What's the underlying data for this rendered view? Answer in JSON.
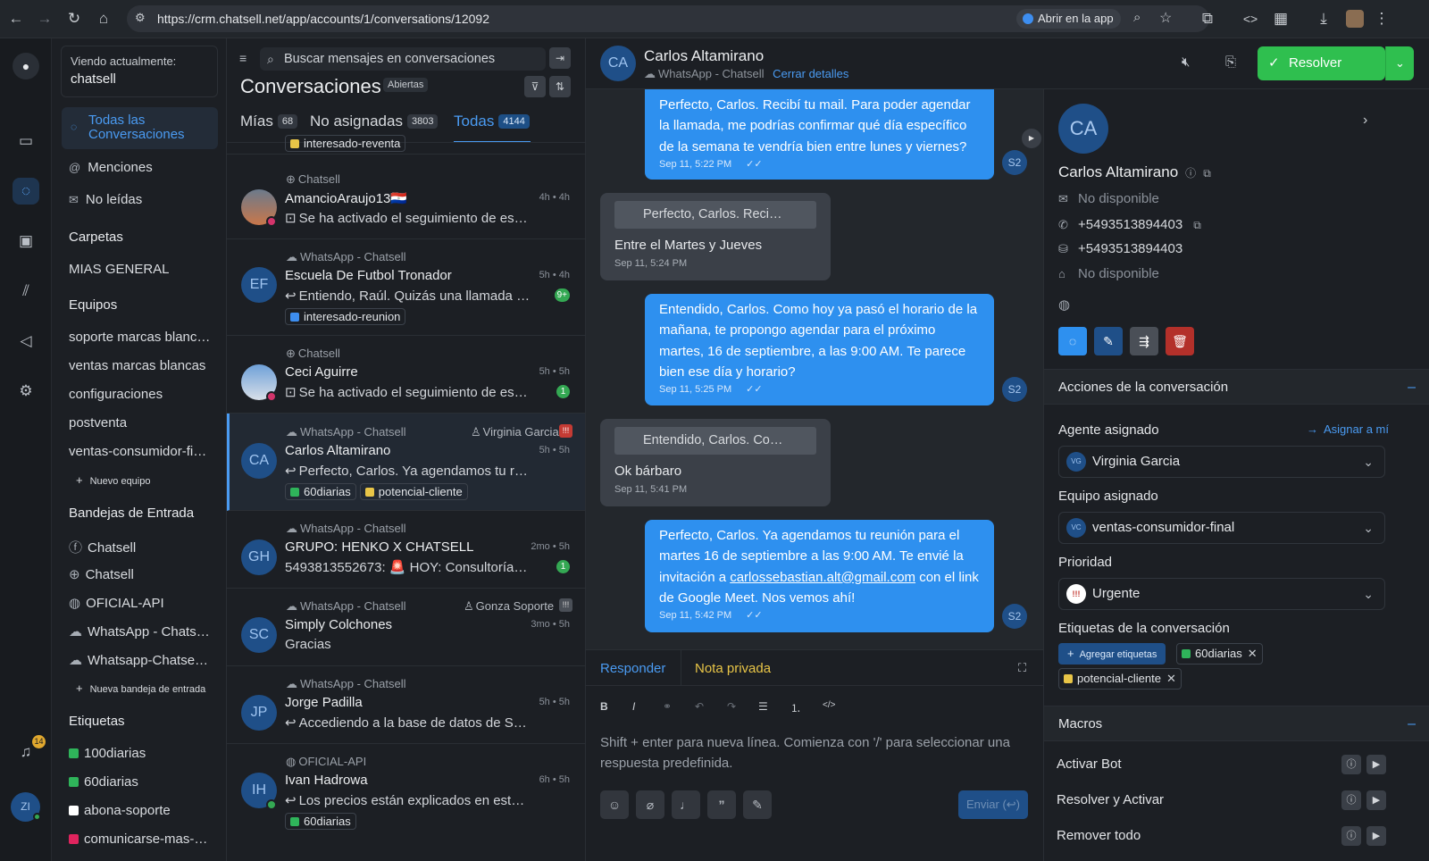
{
  "browser": {
    "url": "https://crm.chatsell.net/app/accounts/1/conversations/12092",
    "open_app": "Abrir en la app"
  },
  "rail": {
    "notif_count": "14",
    "user_initials": "ZI"
  },
  "sidebar": {
    "viewing_label": "Viendo actualmente:",
    "viewing_value": "chatsell",
    "all_conversations": "Todas las Conversaciones",
    "mentions": "Menciones",
    "unread": "No leídas",
    "folders_title": "Carpetas",
    "folder_1": "MIAS GENERAL",
    "teams_title": "Equipos",
    "teams": [
      "soporte marcas blanc…",
      "ventas marcas blancas",
      "configuraciones",
      "postventa",
      "ventas-consumidor-fi…"
    ],
    "new_team": "Nuevo equipo",
    "inboxes_title": "Bandejas de Entrada",
    "inboxes": [
      "Chatsell",
      "Chatsell",
      "OFICIAL-API",
      "WhatsApp - Chats…",
      "Whatsapp-Chatse…"
    ],
    "new_inbox": "Nueva bandeja de entrada",
    "labels_title": "Etiquetas",
    "labels": [
      {
        "name": "100diarias",
        "color": "#2fb45a"
      },
      {
        "name": "60diarias",
        "color": "#2fb45a"
      },
      {
        "name": "abona-soporte",
        "color": "#ffffff"
      },
      {
        "name": "comunicarse-mas-…",
        "color": "#e0245e"
      }
    ]
  },
  "list": {
    "search_placeholder": "Buscar mensajes en conversaciones",
    "title": "Conversaciones",
    "status": "Abiertas",
    "tabs": [
      {
        "label": "Mías",
        "count": "68"
      },
      {
        "label": "No asignadas",
        "count": "3803"
      },
      {
        "label": "Todas",
        "count": "4144"
      }
    ],
    "partial_tag": "interesado-reventa",
    "conversations": [
      {
        "inbox": "Chatsell",
        "agent": "",
        "name": "AmancioAraujo13🇵🇾",
        "msg": "Se ha activado el seguimiento de est…",
        "time": "4h • 4h",
        "initials": "",
        "tags": [],
        "badge": ""
      },
      {
        "inbox": "WhatsApp - Chatsell",
        "agent": "",
        "name": "Escuela De Futbol Tronador",
        "msg": "Entiendo, Raúl. Quizás una llamada r…",
        "time": "5h • 4h",
        "initials": "EF",
        "tags": [
          {
            "name": "interesado-reunion",
            "color": "#3d8ef0"
          }
        ],
        "badge": "9+"
      },
      {
        "inbox": "Chatsell",
        "agent": "",
        "name": "Ceci Aguirre",
        "msg": "Se ha activado el seguimiento de es…",
        "time": "5h • 5h",
        "initials": "",
        "tags": [],
        "badge": "1"
      },
      {
        "inbox": "WhatsApp - Chatsell",
        "agent": "Virginia Garcia",
        "name": "Carlos Altamirano",
        "msg": "Perfecto, Carlos. Ya agendamos tu r…",
        "time": "5h • 5h",
        "initials": "CA",
        "tags": [
          {
            "name": "60diarias",
            "color": "#2fb45a"
          },
          {
            "name": "potencial-cliente",
            "color": "#e8c547"
          }
        ],
        "badge": ""
      },
      {
        "inbox": "WhatsApp - Chatsell",
        "agent": "",
        "name": "GRUPO: HENKO X CHATSELL",
        "msg": "5493813552673: 🚨 HOY: Consultoría T…",
        "time": "2mo • 5h",
        "initials": "GH",
        "tags": [],
        "badge": "1"
      },
      {
        "inbox": "WhatsApp - Chatsell",
        "agent": "Gonza Soporte",
        "name": "Simply Colchones",
        "msg": "Gracias",
        "time": "3mo • 5h",
        "initials": "SC",
        "tags": [],
        "badge": ""
      },
      {
        "inbox": "WhatsApp - Chatsell",
        "agent": "",
        "name": "Jorge Padilla",
        "msg": "Accediendo a la base de datos de S…",
        "time": "5h • 5h",
        "initials": "JP",
        "tags": [],
        "badge": ""
      },
      {
        "inbox": "OFICIAL-API",
        "agent": "",
        "name": "Ivan Hadrowa",
        "msg": "Los precios están explicados en est…",
        "time": "6h • 5h",
        "initials": "IH",
        "tags": [
          {
            "name": "60diarias",
            "color": "#2fb45a"
          }
        ],
        "badge": ""
      }
    ]
  },
  "chat": {
    "contact_initials": "CA",
    "contact_name": "Carlos Altamirano",
    "inbox": "WhatsApp - Chatsell",
    "close_details": "Cerrar detalles",
    "resolve": "Resolver",
    "messages": [
      {
        "dir": "out",
        "text": "Perfecto, Carlos. Recibí tu mail. Para poder agendar la llamada, me podrías confirmar qué día específico de la semana te vendría bien entre lunes y viernes?",
        "time": "Sep 11, 5:22 PM"
      },
      {
        "dir": "in",
        "quote": "Perfecto, Carlos. Reci…",
        "text": "Entre el Martes y Jueves",
        "time": "Sep 11, 5:24 PM"
      },
      {
        "dir": "out",
        "text": "Entendido, Carlos. Como hoy ya pasó el horario de la mañana, te propongo agendar para el próximo martes, 16 de septiembre, a las 9:00 AM. Te parece bien ese día y horario?",
        "time": "Sep 11, 5:25 PM"
      },
      {
        "dir": "in",
        "quote": "Entendido, Carlos. Co…",
        "text": "Ok bárbaro",
        "time": "Sep 11, 5:41 PM"
      },
      {
        "dir": "out",
        "text_before": "Perfecto, Carlos. Ya agendamos tu reunión para el martes 16 de septiembre a las 9:00 AM. Te envié la invitación a ",
        "link": "carlossebastian.alt@gmail.com",
        "text_after": " con el link de Google Meet. Nos vemos ahí!",
        "time": "Sep 11, 5:42 PM"
      }
    ],
    "agent_initials": "S2",
    "reply_tab": "Responder",
    "note_tab": "Nota privada",
    "composer_placeholder": "Shift + enter para nueva línea. Comienza con '/' para seleccionar una respuesta predefinida.",
    "send": "Enviar (↩)"
  },
  "details": {
    "initials": "CA",
    "name": "Carlos Altamirano",
    "email": "No disponible",
    "phone": "+5493513894403",
    "identifier": "+5493513894403",
    "company": "No disponible",
    "actions_title": "Acciones de la conversación",
    "agent_label": "Agente asignado",
    "assign_me": "Asignar a mí",
    "agent_initials": "VG",
    "agent_value": "Virginia Garcia",
    "team_label": "Equipo asignado",
    "team_initials": "VC",
    "team_value": "ventas-consumidor-final",
    "priority_label": "Prioridad",
    "priority_value": "Urgente",
    "tags_label": "Etiquetas de la conversación",
    "add_tags": "Agregar etiquetas",
    "tags": [
      {
        "name": "60diarias",
        "color": "#2fb45a"
      },
      {
        "name": "potencial-cliente",
        "color": "#e8c547"
      }
    ],
    "macros_title": "Macros",
    "macros": [
      "Activar Bot",
      "Resolver y Activar",
      "Remover todo"
    ]
  },
  "colors": {
    "accent": "#2e90ef",
    "resolve": "#2fbf4f",
    "danger": "#d0342c"
  }
}
